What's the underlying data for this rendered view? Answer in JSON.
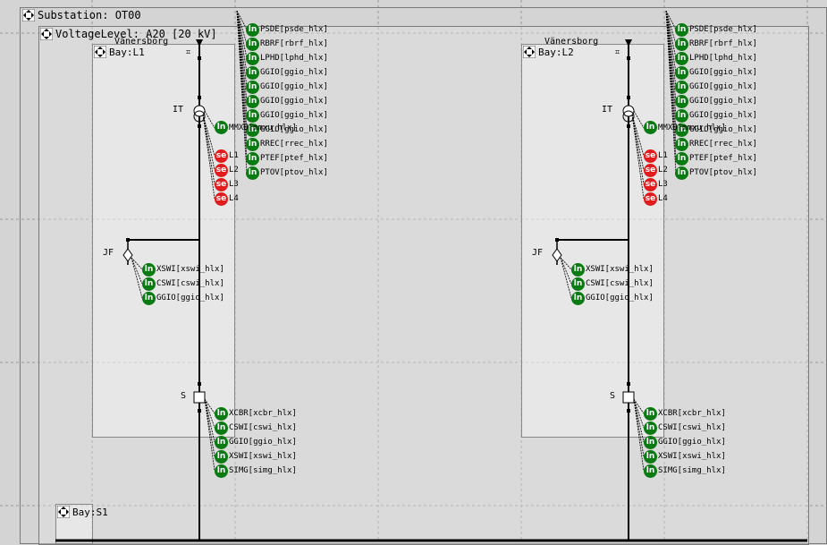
{
  "substation": {
    "title": "Substation: OT00"
  },
  "voltage_level": {
    "title": "VoltageLevel: A20 [20 kV]"
  },
  "location_name": "Vänersborg",
  "bays": [
    {
      "title": "Bay:L1",
      "location": "Vänersborg",
      "it_label": "IT",
      "jf_label": "JF",
      "s_label": "S",
      "terminal_mark": "⌗",
      "top_nodes": [
        "PSDE[psde_hlx]",
        "RBRF[rbrf_hlx]",
        "LPHD[lphd_hlx]",
        "GGIO[ggio_hlx]",
        "GGIO[ggio_hlx]",
        "GGIO[ggio_hlx]",
        "GGIO[ggio_hlx]",
        "GGIO[ggio_hlx]",
        "RREC[rrec_hlx]",
        "PTEF[ptef_hlx]",
        "PTOV[ptov_hlx]"
      ],
      "it_node": "MMXU[mmxu_hlx]",
      "sensors": [
        "L1",
        "L2",
        "L3",
        "L4"
      ],
      "jf_nodes": [
        "XSWI[xswi_hlx]",
        "CSWI[cswi_hlx]",
        "GGIO[ggio_hlx]"
      ],
      "s_nodes": [
        "XCBR[xcbr_hlx]",
        "CSWI[cswi_hlx]",
        "GGIO[ggio_hlx]",
        "XSWI[xswi_hlx]",
        "SIMG[simg_hlx]"
      ]
    },
    {
      "title": "Bay:L2",
      "location": "Vänersborg",
      "it_label": "IT",
      "jf_label": "JF",
      "s_label": "S",
      "terminal_mark": "⌗",
      "top_nodes": [
        "PSDE[psde_hlx]",
        "RBRF[rbrf_hlx]",
        "LPHD[lphd_hlx]",
        "GGIO[ggio_hlx]",
        "GGIO[ggio_hlx]",
        "GGIO[ggio_hlx]",
        "GGIO[ggio_hlx]",
        "GGIO[ggio_hlx]",
        "RREC[rrec_hlx]",
        "PTEF[ptef_hlx]",
        "PTOV[ptov_hlx]"
      ],
      "it_node": "MMXU[mmxu_hlx]",
      "sensors": [
        "L1",
        "L2",
        "L3",
        "L4"
      ],
      "jf_nodes": [
        "XSWI[xswi_hlx]",
        "CSWI[cswi_hlx]",
        "GGIO[ggio_hlx]"
      ],
      "s_nodes": [
        "XCBR[xcbr_hlx]",
        "CSWI[cswi_hlx]",
        "GGIO[ggio_hlx]",
        "XSWI[xswi_hlx]",
        "SIMG[simg_hlx]"
      ]
    }
  ],
  "busbar_bay": {
    "title": "Bay:S1"
  },
  "badges": {
    "ln": "ln",
    "se": "se"
  },
  "colors": {
    "ln": "#0a7a12",
    "se": "#e01c1c",
    "background": "#d4d4d4",
    "line": "#000000"
  }
}
